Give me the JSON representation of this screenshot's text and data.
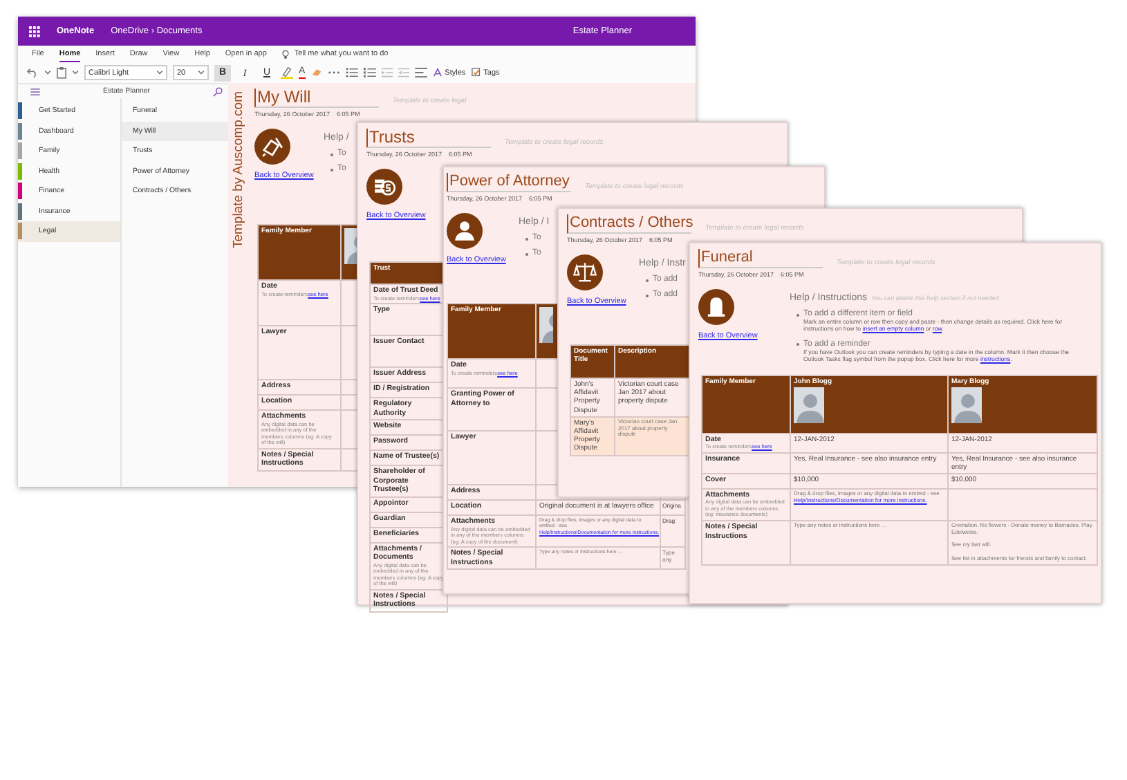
{
  "app": {
    "name": "OneNote",
    "breadcrumb": "OneDrive › Documents",
    "notebook_title": "Estate Planner"
  },
  "ribbon_tabs": [
    {
      "label": "File",
      "selected": false
    },
    {
      "label": "Home",
      "selected": true
    },
    {
      "label": "Insert",
      "selected": false
    },
    {
      "label": "Draw",
      "selected": false
    },
    {
      "label": "View",
      "selected": false
    },
    {
      "label": "Help",
      "selected": false
    },
    {
      "label": "Open in app",
      "selected": false
    }
  ],
  "tell_me": "Tell me what you want to do",
  "toolbar": {
    "font_name": "Calibri Light",
    "font_size": "20",
    "format_buttons": [
      {
        "label": "B",
        "pressed": true
      },
      {
        "label": "I",
        "pressed": false
      },
      {
        "label": "U",
        "pressed": false
      }
    ],
    "font_color_label": "A",
    "styles_label": "Styles",
    "tags_label": "Tags"
  },
  "sidebar": {
    "notebook": "Estate Planner",
    "sections": [
      {
        "label": "Get Started",
        "color": "#2b5f91",
        "selected": false
      },
      {
        "label": "Dashboard",
        "color": "#6f8390",
        "selected": false
      },
      {
        "label": "Family",
        "color": "#a6a6a6",
        "selected": false
      },
      {
        "label": "Health",
        "color": "#7cbb00",
        "selected": false
      },
      {
        "label": "Finance",
        "color": "#d1007a",
        "selected": false
      },
      {
        "label": "Insurance",
        "color": "#60737f",
        "selected": false
      },
      {
        "label": "Legal",
        "color": "#b58e5f",
        "selected": true
      }
    ],
    "pages": [
      {
        "label": "Funeral",
        "selected": false
      },
      {
        "label": "My Will",
        "selected": true
      },
      {
        "label": "Trusts",
        "selected": false
      },
      {
        "label": "Power of Attorney",
        "selected": false
      },
      {
        "label": "Contracts / Others",
        "selected": false
      }
    ]
  },
  "pages": [
    {
      "side_caption": "Template by Auscomp.com",
      "title": "My Will",
      "date": "Thursday, 26 October 2017",
      "time": "6:05 PM",
      "template_note": "Template to create legal",
      "kind": "will",
      "back_link": "Back to Overview",
      "help": {
        "heading": "Help /",
        "bullets": [
          {
            "title": "To"
          },
          {
            "title": "To"
          }
        ]
      },
      "table": {
        "label_heading": "Family Member",
        "columns": [
          {
            "photo": true
          }
        ],
        "rows": [
          {
            "label": "Date",
            "hint": {
              "text": "To create reminders",
              "link": "see here"
            },
            "cells": [
              null
            ],
            "highlighted": false
          },
          {
            "label": "Lawyer",
            "cells": [
              null
            ],
            "highlighted": false
          },
          {
            "label": "Address",
            "cells": [
              null
            ],
            "highlighted": false
          },
          {
            "label": "Location",
            "cells": [
              null
            ],
            "highlighted": false
          },
          {
            "label": "Attachments",
            "hint": {
              "text": "Any digital data can be embedded in any of the members columns (eg: A copy of the will)"
            },
            "cells": [
              null
            ],
            "highlighted": false
          },
          {
            "label": "Notes / Special Instructions",
            "cells": [
              null
            ],
            "highlighted": false
          }
        ]
      }
    },
    {
      "title": "Trusts",
      "date": "Thursday, 26 October 2017",
      "time": "6:05 PM",
      "template_note": "Template to create legal records",
      "kind": "trust",
      "back_link": "Back to Overview",
      "table": {
        "label_heading": "Trust",
        "rows": [
          {
            "label": "Date of Trust Deed",
            "hint": {
              "text": "To create reminders",
              "link": "see here"
            },
            "cells": [],
            "highlighted": false
          },
          {
            "label": "Type",
            "cells": [],
            "highlighted": false
          },
          {
            "label": "Issuer Contact",
            "cells": [],
            "highlighted": false
          },
          {
            "label": "Issuer Address",
            "cells": [],
            "highlighted": false
          },
          {
            "label": "ID / Registration",
            "cells": [],
            "highlighted": false
          },
          {
            "label": "Regulatory Authority",
            "cells": [],
            "highlighted": false
          },
          {
            "label": "Website",
            "cells": [],
            "highlighted": false
          },
          {
            "label": "Password",
            "cells": [],
            "highlighted": false
          },
          {
            "label": "Name of Trustee(s)",
            "cells": [],
            "highlighted": false
          },
          {
            "label": "Shareholder of Corporate Trustee(s)",
            "cells": [],
            "highlighted": false
          },
          {
            "label": "Appointor",
            "cells": [],
            "highlighted": false
          },
          {
            "label": "Guardian",
            "cells": [],
            "highlighted": false
          },
          {
            "label": "Beneficiaries",
            "cells": [],
            "highlighted": false
          },
          {
            "label": "Attachments / Documents",
            "hint": {
              "text": "Any digital data can be embedded in any of the members columns (eg: A copy of the will)"
            },
            "cells": [],
            "highlighted": false
          },
          {
            "label": "Notes / Special Instructions",
            "cells": [],
            "highlighted": false
          }
        ]
      }
    },
    {
      "title": "Power of Attorney",
      "date": "Thursday, 26 October 2017",
      "time": "6:05 PM",
      "template_note": "Template to create legal records",
      "kind": "person",
      "back_link": "Back to Overview",
      "help": {
        "heading": "Help / I",
        "bullets": [
          {
            "title": "To"
          },
          {
            "title": "To"
          }
        ]
      },
      "table": {
        "label_heading": "Family Member",
        "columns": [
          {
            "photo": true
          }
        ],
        "rows": [
          {
            "label": "Date",
            "hint": {
              "text": "To create reminders",
              "link": "see here"
            },
            "cells": [
              null,
              null
            ],
            "highlighted": false
          },
          {
            "label": "Granting Power of Attorney to",
            "cells": [
              null,
              null
            ],
            "highlighted": false
          },
          {
            "label": "Lawyer",
            "cells": [
              null,
              null
            ],
            "highlighted": false
          },
          {
            "label": "Address",
            "cells": [
              null,
              null
            ],
            "highlighted": false
          },
          {
            "label": "Location",
            "cells": [
              "Original document is at lawyers office",
              "Origina"
            ],
            "highlighted": false
          },
          {
            "label": "Attachments",
            "hint": {
              "text": "Any digital data can be embedded in any of the members columns (eg: A copy of the document)"
            },
            "cells": [
              {
                "text": "Drag & drop files, images or any digital data to embed - see",
                "link": "Help/Instructions/Documentation for more instructions."
              },
              "Drag"
            ],
            "highlighted": false
          },
          {
            "label": "Notes / Special Instructions",
            "cells": [
              "Type any notes or instructions here ...",
              "Type any"
            ],
            "highlighted": false
          }
        ]
      }
    },
    {
      "title": "Contracts / Others",
      "date": "Thursday, 26 October 2017",
      "time": "6:05 PM",
      "template_note": "Template to create legal records",
      "kind": "scales",
      "back_link": "Back to Overview",
      "help": {
        "heading": "Help / Instr",
        "bullets": [
          {
            "title": "To add"
          },
          {
            "title": "To add"
          }
        ]
      },
      "table": {
        "label_heading": "Document Title",
        "columns": [
          {
            "label": "Description",
            "photo": false
          }
        ],
        "rows": [
          {
            "label": "John's Affidavit Property Dispute",
            "plain": true,
            "cells": [
              "Victorian court case Jan 2017 about property dispute",
              null
            ],
            "highlighted": false
          },
          {
            "label": "Mary's Affidavit Property Dispute",
            "plain": true,
            "cells": [
              "Victorian court case Jan 2017 about property dispute",
              null
            ],
            "highlighted": true
          }
        ]
      }
    },
    {
      "title": "Funeral",
      "date": "Thursday, 26 October 2017",
      "time": "6:05 PM",
      "template_note": "Template to create legal records",
      "kind": "tombstone",
      "back_link": "Back to Overview",
      "help": {
        "heading": "Help / Instructions",
        "note": "You can delete this help section if not needed",
        "bullets": [
          {
            "title": "To add a different item or field",
            "parts": [
              {
                "text": "Mark an entire column or row then copy and paste - then change details as required. Click here for instructions on how to "
              },
              {
                "link": "insert an empty column"
              },
              {
                "text": " or "
              },
              {
                "link": "row"
              },
              {
                "text": "."
              }
            ]
          },
          {
            "title": "To add a reminder",
            "parts": [
              {
                "text": "If you have Outlook you can create reminders by typing a date in the column. Mark it then choose the Outlook Tasks flag symbol from the popup box. Click here for more "
              },
              {
                "link": "instructions"
              },
              {
                "text": "."
              }
            ]
          }
        ]
      },
      "table": {
        "label_heading": "Family Member",
        "columns": [
          {
            "label": "John Blogg",
            "photo": true
          },
          {
            "label": "Mary Blogg",
            "photo": true
          }
        ],
        "rows": [
          {
            "label": "Date",
            "hint": {
              "text": "To create reminders",
              "link": "see here"
            },
            "cells": [
              "12-JAN-2012",
              "12-JAN-2012"
            ],
            "highlighted": false
          },
          {
            "label": "Insurance",
            "cells": [
              "Yes, Real Insurance - see also insurance entry",
              "Yes, Real Insurance - see also insurance entry"
            ],
            "highlighted": false
          },
          {
            "label": "Cover",
            "cells": [
              "$10,000",
              "$10,000"
            ],
            "highlighted": false
          },
          {
            "label": "Attachments",
            "hint": {
              "text": "Any digital data can be embedded in any of the members columns (eg: insurance documents)"
            },
            "cells": [
              {
                "text": "Drag & drop files, images or any digital data to embed - see",
                "link": "Help/Instructions/Documentation for more instructions."
              },
              null
            ],
            "highlighted": false
          },
          {
            "label": "Notes / Special Instructions",
            "cells": [
              "Type any notes or instructions here ...",
              "Cremation. No flowers - Donate money to Barnados. Play Edelweiss.\n\nSee my last will.\n\nSee list in attachments for friends and family to contact."
            ],
            "highlighted": false
          }
        ]
      }
    }
  ]
}
